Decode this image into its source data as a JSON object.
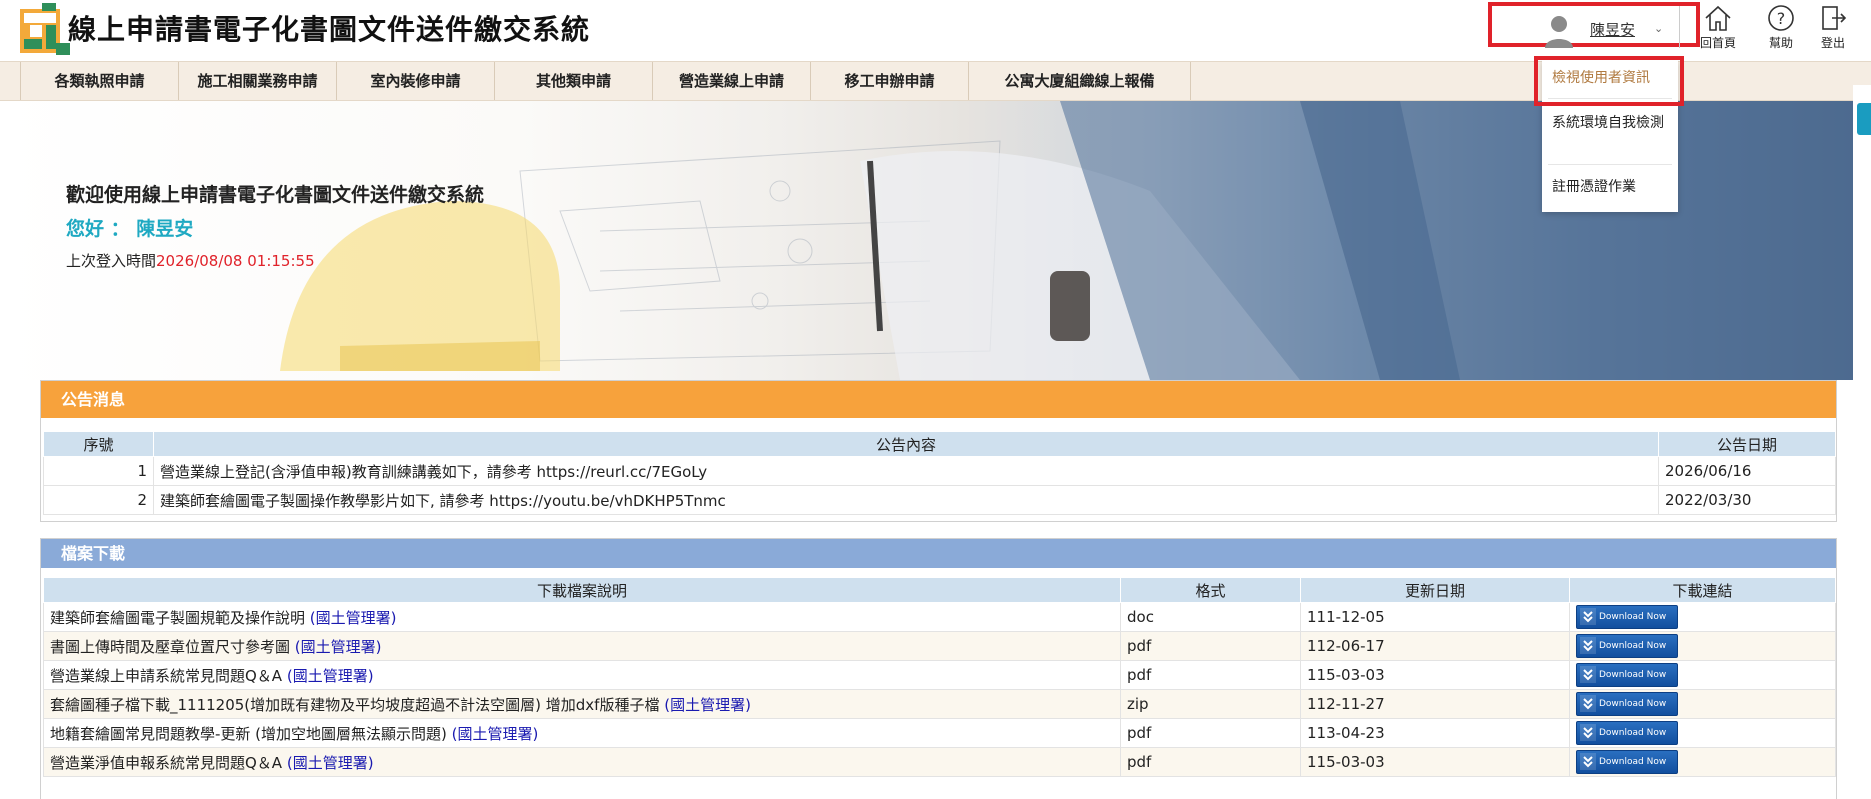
{
  "header": {
    "title": "線上申請書電子化書圖文件送件繳交系統",
    "user_name": "陳昱安",
    "home_label": "回首頁",
    "help_label": "幫助",
    "logout_label": "登出"
  },
  "nav": {
    "items": [
      {
        "label": "各類執照申請"
      },
      {
        "label": "施工相關業務申請"
      },
      {
        "label": "室內裝修申請"
      },
      {
        "label": "其他類申請"
      },
      {
        "label": "營造業線上申請"
      },
      {
        "label": "移工申辦申請"
      },
      {
        "label": "公寓大廈組織線上報備"
      }
    ]
  },
  "user_menu": {
    "items": [
      {
        "label": "檢視使用者資訊"
      },
      {
        "label": "系統環境自我檢測"
      },
      {
        "label": "註冊憑證作業"
      }
    ]
  },
  "banner": {
    "welcome": "歡迎使用線上申請書電子化書圖文件送件繳交系統",
    "hello_label": "您好 ： 陳昱安",
    "last_login_label": "上次登入時間",
    "last_login_time": "2026/08/08 01:15:55"
  },
  "notice": {
    "title": "公告消息",
    "headers": {
      "no": "序號",
      "content": "公告內容",
      "date": "公告日期"
    },
    "rows": [
      {
        "no": "1",
        "content": "營造業線上登記(含淨值申報)教育訓練講義如下，請參考 https://reurl.cc/7EGoLy",
        "date": "2026/06/16"
      },
      {
        "no": "2",
        "content": "建築師套繪圖電子製圖操作教學影片如下, 請參考 https://youtu.be/vhDKHP5Tnmc",
        "date": "2022/03/30"
      }
    ]
  },
  "files": {
    "title": "檔案下載",
    "headers": {
      "desc": "下載檔案說明",
      "format": "格式",
      "updated": "更新日期",
      "link": "下載連結"
    },
    "download_label": "Download Now",
    "rows": [
      {
        "desc": "建築師套繪圖電子製圖規範及操作說明",
        "source": "(國土管理署)",
        "format": "doc",
        "updated": "111-12-05"
      },
      {
        "desc": "書圖上傳時間及壓章位置尺寸參考圖",
        "source": "(國土管理署)",
        "format": "pdf",
        "updated": "112-06-17"
      },
      {
        "desc": "營造業線上申請系統常見問題Q＆A",
        "source": "(國土管理署)",
        "format": "pdf",
        "updated": "115-03-03"
      },
      {
        "desc": "套繪圖種子檔下載_1111205(增加既有建物及平均坡度超過不計法空圖層) 增加dxf版種子檔",
        "source": "(國土管理署)",
        "format": "zip",
        "updated": "112-11-27"
      },
      {
        "desc": "地籍套繪圖常見問題教學-更新 (增加空地圖層無法顯示問題)",
        "source": "(國土管理署)",
        "format": "pdf",
        "updated": "113-04-23"
      },
      {
        "desc": "營造業淨值申報系統常見問題Q＆A",
        "source": "(國土管理署)",
        "format": "pdf",
        "updated": "115-03-03"
      }
    ]
  },
  "colors": {
    "highlight": "#e0222a",
    "notice_header": "#f7a23c",
    "files_header": "#8aaad8",
    "welcome_name": "#1fa9c2",
    "link": "#1a1ab0"
  }
}
